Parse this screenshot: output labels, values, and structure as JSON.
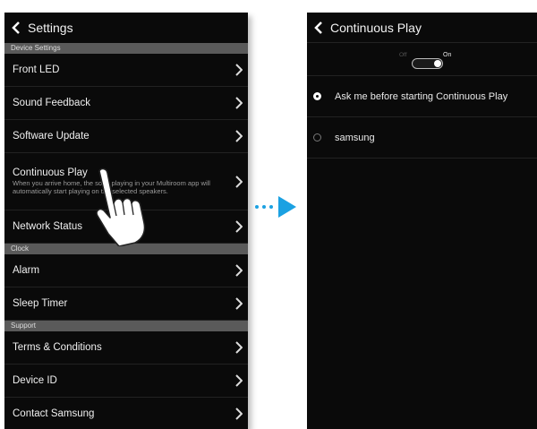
{
  "left": {
    "title": "Settings",
    "sections": [
      {
        "header": "Device Settings",
        "items": [
          {
            "label": "Front LED"
          },
          {
            "label": "Sound Feedback"
          },
          {
            "label": "Software Update"
          },
          {
            "label": "Continuous Play",
            "description": "When you arrive home, the song playing in your Multiroom app will automatically start playing on the selected speakers."
          },
          {
            "label": "Network Status"
          }
        ]
      },
      {
        "header": "Clock",
        "items": [
          {
            "label": "Alarm"
          },
          {
            "label": "Sleep Timer"
          }
        ]
      },
      {
        "header": "Support",
        "items": [
          {
            "label": "Terms & Conditions"
          },
          {
            "label": "Device ID"
          },
          {
            "label": "Contact Samsung"
          }
        ]
      }
    ]
  },
  "right": {
    "title": "Continuous Play",
    "toggle": {
      "off_label": "Off",
      "on_label": "On",
      "state": "on"
    },
    "options": [
      {
        "label": "Ask me before starting Continuous Play",
        "selected": true
      },
      {
        "label": "samsung",
        "selected": false
      }
    ]
  },
  "colors": {
    "screen_bg": "#0a0a0a",
    "section_header_bg": "#5a5a5a",
    "arrow": "#1ba1e2"
  },
  "icons": [
    "back-chevron-icon",
    "chevron-right-icon",
    "pointing-hand-icon",
    "dotted-arrow-icon"
  ]
}
